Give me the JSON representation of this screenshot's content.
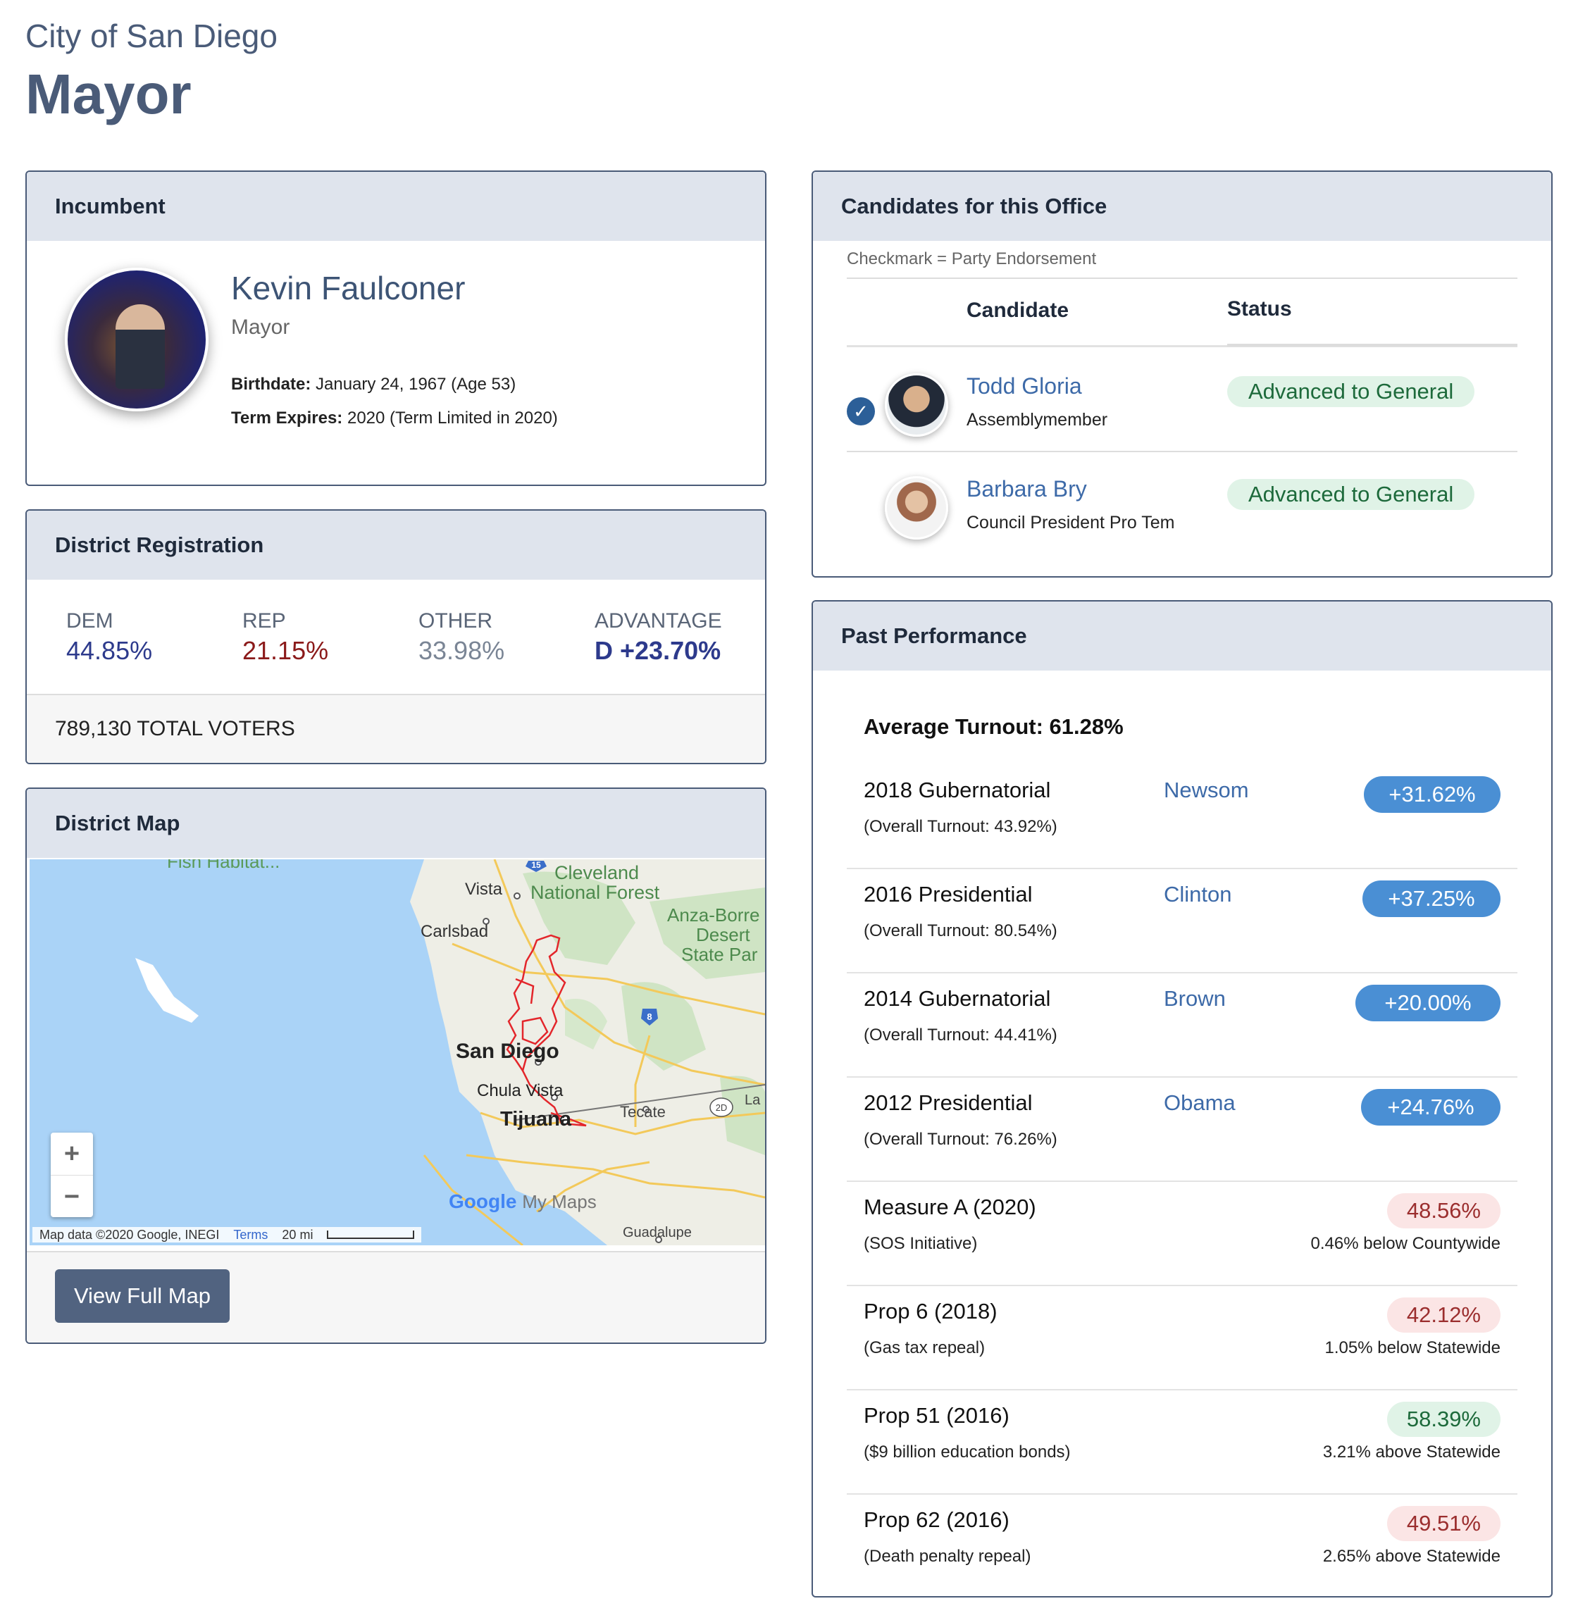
{
  "header": {
    "pre_title": "City of San Diego",
    "title": "Mayor"
  },
  "incumbent": {
    "heading": "Incumbent",
    "name": "Kevin Faulconer",
    "role": "Mayor",
    "birthdate_label": "Birthdate:",
    "birthdate_value": "January 24, 1967 (Age 53)",
    "term_label": "Term Expires:",
    "term_value": "2020 (Term Limited in 2020)"
  },
  "registration": {
    "heading": "District Registration",
    "dem_label": "DEM",
    "dem_value": "44.85%",
    "rep_label": "REP",
    "rep_value": "21.15%",
    "other_label": "OTHER",
    "other_value": "33.98%",
    "adv_label": "ADVANTAGE",
    "adv_value": "D +23.70%",
    "total": "789,130 TOTAL VOTERS",
    "colors": {
      "dem": "#2d3a8c",
      "rep": "#8b1a1a",
      "other": "#7a8595"
    }
  },
  "map": {
    "heading": "District Map",
    "labels": {
      "fish": "Fish Habitat...",
      "cleveland": "Cleveland",
      "national_forest": "National Forest",
      "vista": "Vista",
      "carlsbad": "Carlsbad",
      "anza1": "Anza-Borre",
      "anza2": "Desert",
      "anza3": "State Par",
      "san_diego": "San Diego",
      "chula_vista": "Chula Vista",
      "tijuana": "Tijuana",
      "tecate": "Tecate",
      "la": "La",
      "guadalupe": "Guadalupe",
      "shield_15": "15",
      "shield_8": "8",
      "shield_2d": "2D"
    },
    "zoom_in": "+",
    "zoom_out": "−",
    "google": "Google",
    "my_maps": "My Maps",
    "attribution": "Map data ©2020 Google, INEGI",
    "terms": "Terms",
    "scale": "20 mi",
    "button": "View Full Map"
  },
  "candidates": {
    "heading": "Candidates for this Office",
    "note": "Checkmark = Party Endorsement",
    "col_candidate": "Candidate",
    "col_status": "Status",
    "rows": [
      {
        "name": "Todd Gloria",
        "role": "Assemblymember",
        "status": "Advanced to General",
        "endorsed": "✓"
      },
      {
        "name": "Barbara Bry",
        "role": "Council President Pro Tem",
        "status": "Advanced to General",
        "endorsed": ""
      }
    ]
  },
  "past": {
    "heading": "Past Performance",
    "average": "Average Turnout: 61.28%",
    "elections": [
      {
        "name": "2018 Gubernatorial",
        "turnout": "(Overall Turnout: 43.92%)",
        "candidate": "Newsom",
        "margin": "+31.62%"
      },
      {
        "name": "2016 Presidential",
        "turnout": "(Overall Turnout: 80.54%)",
        "candidate": "Clinton",
        "margin": "+37.25%"
      },
      {
        "name": "2014 Gubernatorial",
        "turnout": "(Overall Turnout: 44.41%)",
        "candidate": "Brown",
        "margin": "+20.00%"
      },
      {
        "name": "2012 Presidential",
        "turnout": "(Overall Turnout: 76.26%)",
        "candidate": "Obama",
        "margin": "+24.76%"
      }
    ],
    "measures": [
      {
        "name": "Measure A (2020)",
        "desc": "(SOS Initiative)",
        "value": "48.56%",
        "compare": "0.46% below Countywide",
        "tone": "neg"
      },
      {
        "name": "Prop 6 (2018)",
        "desc": "(Gas tax repeal)",
        "value": "42.12%",
        "compare": "1.05% below Statewide",
        "tone": "neg"
      },
      {
        "name": "Prop 51 (2016)",
        "desc": "($9 billion education bonds)",
        "value": "58.39%",
        "compare": "3.21% above Statewide",
        "tone": "pos"
      },
      {
        "name": "Prop 62 (2016)",
        "desc": "(Death penalty repeal)",
        "value": "49.51%",
        "compare": "2.65% above Statewide",
        "tone": "neg"
      }
    ]
  }
}
